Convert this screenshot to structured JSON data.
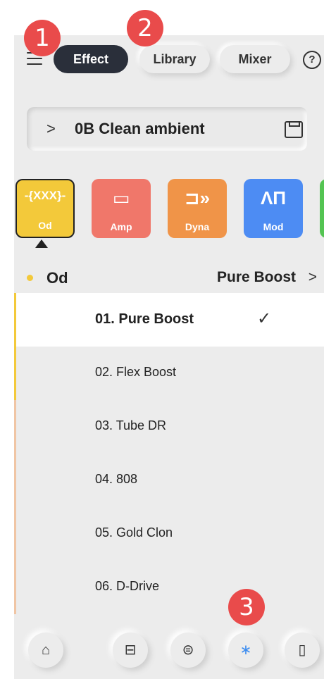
{
  "tabs": [
    {
      "label": "Effect"
    },
    {
      "label": "Library"
    },
    {
      "label": "Mixer"
    }
  ],
  "help": "?",
  "preset": {
    "chevron": ">",
    "name": "0B Clean ambient"
  },
  "effects": [
    {
      "label": "Od",
      "icon": "-{XXX}-",
      "color": "#f3c93a"
    },
    {
      "label": "Amp",
      "icon": "▭",
      "color": "#f0776a"
    },
    {
      "label": "Dyna",
      "icon": "⊐»",
      "color": "#f09448"
    },
    {
      "label": "Mod",
      "icon": "ΛΠ",
      "color": "#4d8cf3"
    },
    {
      "label": "",
      "icon": "",
      "color": "#54c452"
    }
  ],
  "category": {
    "name": "Od",
    "selected": "Pure Boost",
    "chevron": ">"
  },
  "list": [
    {
      "label": "01. Pure Boost",
      "checked": "✓"
    },
    {
      "label": "02. Flex Boost"
    },
    {
      "label": "03. Tube DR"
    },
    {
      "label": "04. 808"
    },
    {
      "label": "05. Gold Clon"
    },
    {
      "label": "06. D-Drive"
    }
  ],
  "badges": [
    "1",
    "2",
    "3"
  ],
  "nav": [
    {
      "icon": "home-icon",
      "glyph": "⌂"
    },
    {
      "icon": "scan-icon",
      "glyph": "⊟"
    },
    {
      "icon": "router-icon",
      "glyph": "⊜"
    },
    {
      "icon": "bluetooth-icon",
      "glyph": "∗"
    },
    {
      "icon": "battery-icon",
      "glyph": "▯"
    }
  ]
}
